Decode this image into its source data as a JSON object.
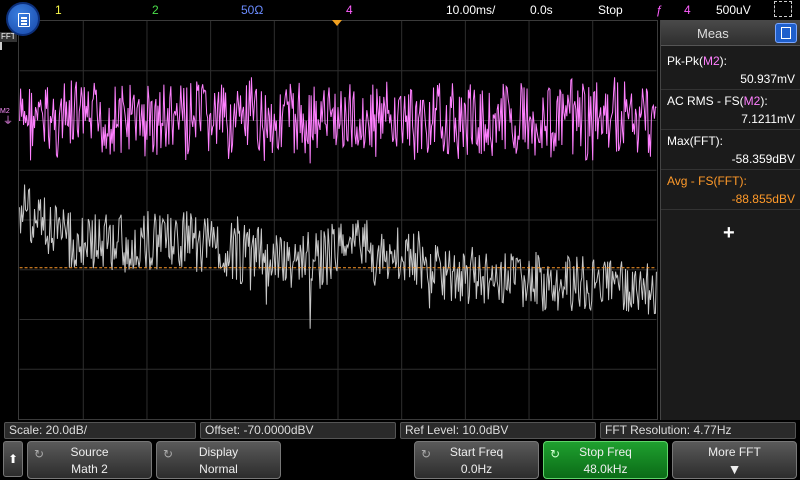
{
  "topbar": {
    "ch1": "1",
    "ch2": "2",
    "ch3": "50Ω",
    "ch4": "4",
    "timebase": "10.00ms/",
    "delay": "0.0s",
    "run_state": "Stop",
    "trigger_source": "4",
    "trigger_level": "500uV",
    "colors": {
      "ch1": "#f7f74a",
      "ch2": "#4adf4a",
      "ch3": "#6b8cff",
      "ch4": "#ff5fff",
      "trigger": "#ff5fff"
    }
  },
  "left_labels": {
    "fft": "FFT",
    "m2": "M2"
  },
  "meas": {
    "title": "Meas",
    "rows": [
      {
        "label_pre": "Pk-Pk(",
        "label_src": "M2",
        "label_post": "):",
        "value": "50.937mV"
      },
      {
        "label_pre": "AC RMS - FS(",
        "label_src": "M2",
        "label_post": "):",
        "value": "7.1211mV"
      },
      {
        "label_pre": "Max(",
        "label_src": "FFT",
        "label_post": "):",
        "value": "-58.359dBV"
      },
      {
        "label_pre": "Avg - FS(",
        "label_src": "FFT",
        "label_post": "):",
        "value": "-88.855dBV"
      }
    ],
    "add_symbol": "+"
  },
  "info": {
    "scale": "Scale: 20.0dB/",
    "offset": "Offset: -70.0000dBV",
    "ref_level": "Ref Level: 10.0dBV",
    "fft_resolution": "FFT Resolution: 4.77Hz"
  },
  "softkeys": {
    "source": {
      "name": "Source",
      "value": "Math 2"
    },
    "display": {
      "name": "Display",
      "value": "Normal"
    },
    "start_freq": {
      "name": "Start Freq",
      "value": "0.0Hz"
    },
    "stop_freq": {
      "name": "Stop Freq",
      "value": "48.0kHz"
    },
    "more_fft": {
      "name": "More FFT"
    }
  },
  "traces": {
    "math_color": "#ff80ff",
    "fft_color": "#c8c8c8",
    "cursor_color": "#ff9a2a"
  }
}
